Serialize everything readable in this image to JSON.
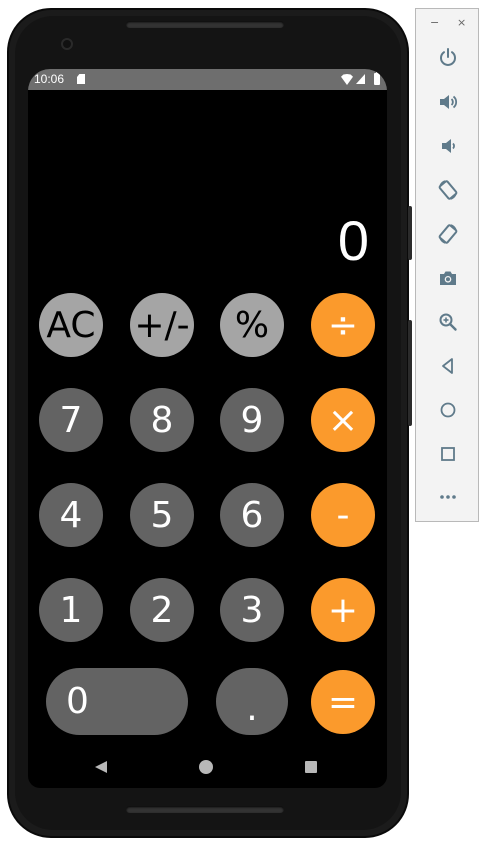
{
  "status_bar": {
    "time": "10:06"
  },
  "display": {
    "value": "0"
  },
  "keys": {
    "ac": "AC",
    "sign": "+/-",
    "percent": "%",
    "divide": "÷",
    "seven": "7",
    "eight": "8",
    "nine": "9",
    "multiply": "×",
    "four": "4",
    "five": "5",
    "six": "6",
    "minus": "-",
    "one": "1",
    "two": "2",
    "three": "3",
    "plus": "+",
    "zero": "0",
    "dot": ".",
    "equals": "="
  },
  "colors": {
    "function_key": "#a5a5a5",
    "number_key": "#636363",
    "operator_key": "#fb9a2c",
    "screen_background": "#000000",
    "display_text": "#ffffff"
  },
  "emulator_toolbar": {
    "minimize_label": "−",
    "close_label": "×",
    "buttons": [
      "power-icon",
      "volume-up-icon",
      "volume-down-icon",
      "rotate-left-icon",
      "rotate-right-icon",
      "screenshot-icon",
      "zoom-icon",
      "back-icon",
      "home-icon",
      "overview-icon",
      "more-icon"
    ]
  },
  "nav_bar": {
    "buttons": [
      "back-icon",
      "home-icon",
      "recents-icon"
    ]
  }
}
